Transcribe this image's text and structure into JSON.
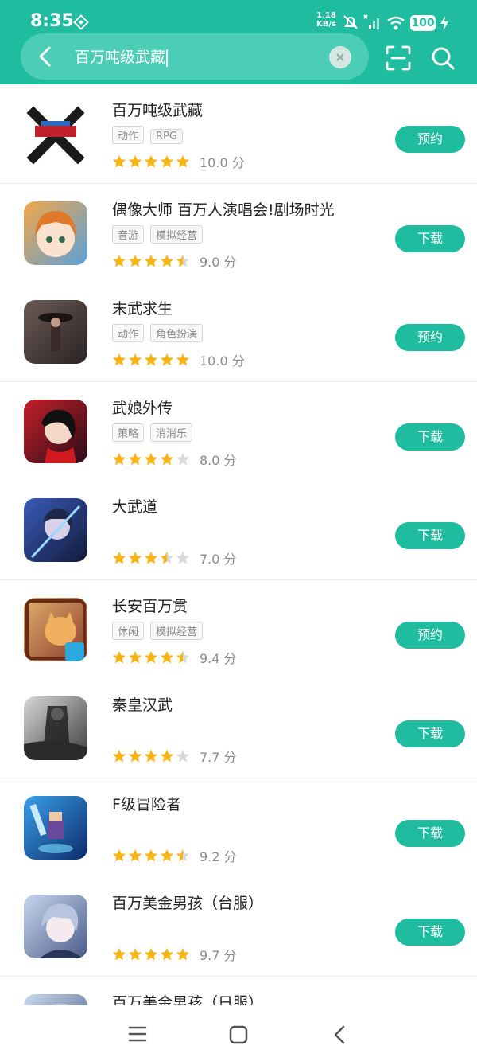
{
  "status_bar": {
    "time": "8:35",
    "speed": "1.18",
    "speed_unit": "KB/s",
    "battery": "100"
  },
  "search": {
    "query": "百万吨级武藏"
  },
  "results": [
    {
      "title": "百万吨级武藏",
      "tags": [
        "动作",
        "RPG"
      ],
      "stars": [
        1,
        1,
        1,
        1,
        1
      ],
      "score": "10.0 分",
      "button": "预约",
      "icon": "x-logo",
      "grad": [
        "#ffffff",
        "#ffffff"
      ]
    },
    {
      "title": "偶像大师 百万人演唱会!剧场时光",
      "tags": [
        "音游",
        "模拟经营"
      ],
      "stars": [
        1,
        1,
        1,
        1,
        0.5
      ],
      "score": "9.0 分",
      "button": "下载",
      "icon": "idol-girl",
      "grad": [
        "#f3a74a",
        "#5aa0d8"
      ]
    },
    {
      "title": "末武求生",
      "tags": [
        "动作",
        "角色扮演"
      ],
      "stars": [
        1,
        1,
        1,
        1,
        1
      ],
      "score": "10.0 分",
      "button": "预约",
      "icon": "warrior",
      "grad": [
        "#6a5a55",
        "#2a2324"
      ]
    },
    {
      "title": "武娘外传",
      "tags": [
        "策略",
        "消消乐"
      ],
      "stars": [
        1,
        1,
        1,
        1,
        0
      ],
      "score": "8.0 分",
      "button": "下载",
      "icon": "red-girl",
      "grad": [
        "#c4202a",
        "#2a0c18"
      ]
    },
    {
      "title": "大武道",
      "tags": [],
      "stars": [
        1,
        1,
        1,
        0.5,
        0
      ],
      "score": "7.0 分",
      "button": "下载",
      "icon": "blue-swordsman",
      "grad": [
        "#3a5bb8",
        "#111a3a"
      ]
    },
    {
      "title": "长安百万贯",
      "tags": [
        "休闲",
        "模拟经营"
      ],
      "stars": [
        1,
        1,
        1,
        1,
        0.5
      ],
      "score": "9.4 分",
      "button": "预约",
      "icon": "cat",
      "grad": [
        "#e0b070",
        "#8a3a28"
      ]
    },
    {
      "title": "秦皇汉武",
      "tags": [],
      "stars": [
        1,
        1,
        1,
        1,
        0
      ],
      "score": "7.7 分",
      "button": "下载",
      "icon": "ink-warrior",
      "grad": [
        "#d8d8d8",
        "#3a3a3a"
      ]
    },
    {
      "title": "F级冒险者",
      "tags": [],
      "stars": [
        1,
        1,
        1,
        1,
        0.5
      ],
      "score": "9.2 分",
      "button": "下载",
      "icon": "pixel-hero",
      "grad": [
        "#3aa0e8",
        "#0c2a6a"
      ]
    },
    {
      "title": "百万美金男孩（台服）",
      "tags": [],
      "stars": [
        1,
        1,
        1,
        1,
        1
      ],
      "score": "9.7 分",
      "button": "下载",
      "icon": "anime-boy",
      "grad": [
        "#c8d8ee",
        "#4a5a88"
      ]
    },
    {
      "title": "百万美金男孩（日服）",
      "tags": [],
      "stars": [],
      "score": "",
      "button": "",
      "icon": "anime-boy",
      "grad": [
        "#c8d8ee",
        "#4a5a88"
      ]
    }
  ],
  "colors": {
    "accent": "#1fbca0",
    "star": "#f7b417",
    "star_empty": "#d9d9d9"
  }
}
